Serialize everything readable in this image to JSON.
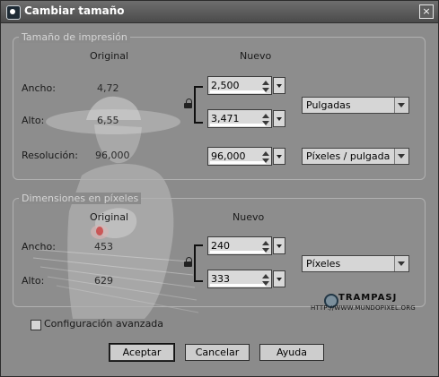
{
  "window": {
    "title": "Cambiar tamaño",
    "close_label": "×"
  },
  "print_size": {
    "legend": "Tamaño de impresión",
    "col_original": "Original",
    "col_new": "Nuevo",
    "width_label": "Ancho:",
    "height_label": "Alto:",
    "resolution_label": "Resolución:",
    "width_original": "4,72",
    "height_original": "6,55",
    "resolution_original": "96,000",
    "width_new": "2,500",
    "height_new": "3,471",
    "resolution_new": "96,000",
    "units": "Pulgadas",
    "resolution_units": "Píxeles / pulgada"
  },
  "pixel_dims": {
    "legend": "Dimensiones en píxeles",
    "col_original": "Original",
    "col_new": "Nuevo",
    "width_label": "Ancho:",
    "height_label": "Alto:",
    "width_original": "453",
    "height_original": "629",
    "width_new": "240",
    "height_new": "333",
    "units": "Píxeles"
  },
  "advanced": {
    "label": "Configuración avanzada",
    "checked": false
  },
  "buttons": {
    "accept": "Aceptar",
    "cancel": "Cancelar",
    "help": "Ayuda"
  },
  "watermark": {
    "name": "TRAMPASJ",
    "url": "HTTP://WWW.MUNDOPIXEL.ORG"
  }
}
